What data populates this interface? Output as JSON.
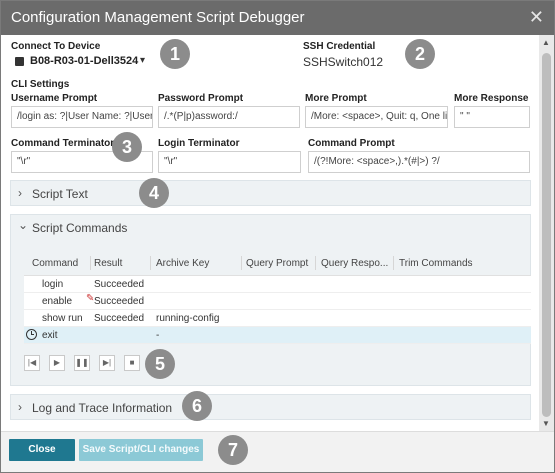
{
  "window": {
    "title": "Configuration Management Script Debugger",
    "close_glyph": "✕"
  },
  "device": {
    "label": "Connect To Device",
    "name": "B08-R03-01-Dell3524",
    "device_icon": "device-icon",
    "caret": "▾"
  },
  "ssh": {
    "label": "SSH Credential",
    "value": "SSHSwitch012"
  },
  "cli": {
    "section_label": "CLI Settings",
    "username_prompt": {
      "label": "Username Prompt",
      "value": "/login as: ?|User Name: ?|User:"
    },
    "password_prompt": {
      "label": "Password Prompt",
      "value": "/.*(P|p)assword:/"
    },
    "more_prompt": {
      "label": "More Prompt",
      "value": "/More: <space>,  Quit: q, One lin"
    },
    "more_response": {
      "label": "More Response",
      "value": "\" \""
    },
    "command_terminator": {
      "label": "Command Terminator",
      "value": "\"\\r\""
    },
    "login_terminator": {
      "label": "Login Terminator",
      "value": "\"\\r\""
    },
    "command_prompt": {
      "label": "Command Prompt",
      "value": "/(?!More: <space>,).*(#|>) ?/"
    }
  },
  "panels": {
    "script_text": {
      "title": "Script Text",
      "chevron": "›"
    },
    "script_commands": {
      "title": "Script Commands",
      "chevron": "⌄"
    },
    "log_trace": {
      "title": "Log and Trace Information",
      "chevron": "›"
    }
  },
  "grid": {
    "columns": [
      "Command",
      "Result",
      "Archive Key",
      "Query Prompt",
      "Query Respo...",
      "Trim Commands"
    ],
    "rows": [
      {
        "command": "login",
        "result": "Succeeded",
        "archive_key": ""
      },
      {
        "command": "enable",
        "result": "Succeeded",
        "archive_key": ""
      },
      {
        "command": "show run",
        "result": "Succeeded",
        "archive_key": "running-config"
      },
      {
        "command": "exit",
        "result": "",
        "archive_key": "-"
      }
    ]
  },
  "controls": {
    "first": "|◀",
    "play": "▶",
    "pause": "❚❚",
    "next": "▶|",
    "stop": "■"
  },
  "badges": [
    "1",
    "2",
    "3",
    "4",
    "5",
    "6",
    "7"
  ],
  "footer": {
    "close": "Close",
    "save": "Save Script/CLI changes"
  },
  "colors": {
    "titlebar": "#6b6b6b",
    "primary": "#1f7890",
    "secondary": "#8cc9d6",
    "badge": "#8c8c8c"
  }
}
